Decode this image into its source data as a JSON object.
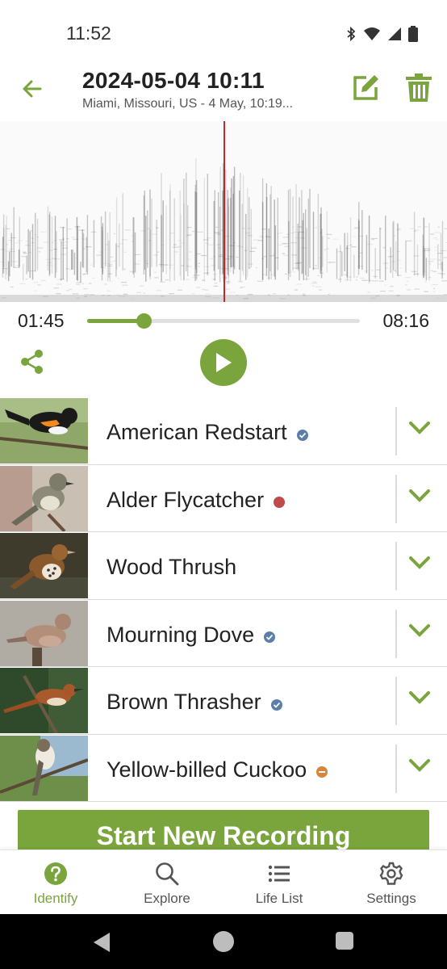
{
  "status_bar": {
    "time": "11:52"
  },
  "header": {
    "title": "2024-05-04 10:11",
    "subtitle": "Miami, Missouri, US - 4 May, 10:19..."
  },
  "player": {
    "current_time": "01:45",
    "total_time": "08:16",
    "progress_percent": 21
  },
  "species": [
    {
      "name": "American Redstart",
      "badge": "verified",
      "badge_color": "#5b7fa8",
      "image_icon": "american-redstart-photo"
    },
    {
      "name": "Alder Flycatcher",
      "badge": "red-dot",
      "badge_color": "#c0494a",
      "image_icon": "alder-flycatcher-photo"
    },
    {
      "name": "Wood Thrush",
      "badge": "none",
      "badge_color": "",
      "image_icon": "wood-thrush-photo"
    },
    {
      "name": "Mourning Dove",
      "badge": "verified",
      "badge_color": "#5b7fa8",
      "image_icon": "mourning-dove-photo"
    },
    {
      "name": "Brown Thrasher",
      "badge": "verified",
      "badge_color": "#5b7fa8",
      "image_icon": "brown-thrasher-photo"
    },
    {
      "name": "Yellow-billed Cuckoo",
      "badge": "minus",
      "badge_color": "#d9843b",
      "image_icon": "yellow-billed-cuckoo-photo"
    }
  ],
  "actions": {
    "record_label": "Start New Recording"
  },
  "nav": {
    "items": [
      {
        "label": "Identify",
        "icon": "help-circle-icon",
        "active": true
      },
      {
        "label": "Explore",
        "icon": "search-icon",
        "active": false
      },
      {
        "label": "Life List",
        "icon": "list-icon",
        "active": false
      },
      {
        "label": "Settings",
        "icon": "gear-icon",
        "active": false
      }
    ]
  },
  "colors": {
    "accent": "#7aa53c",
    "playhead": "#c0282b"
  }
}
